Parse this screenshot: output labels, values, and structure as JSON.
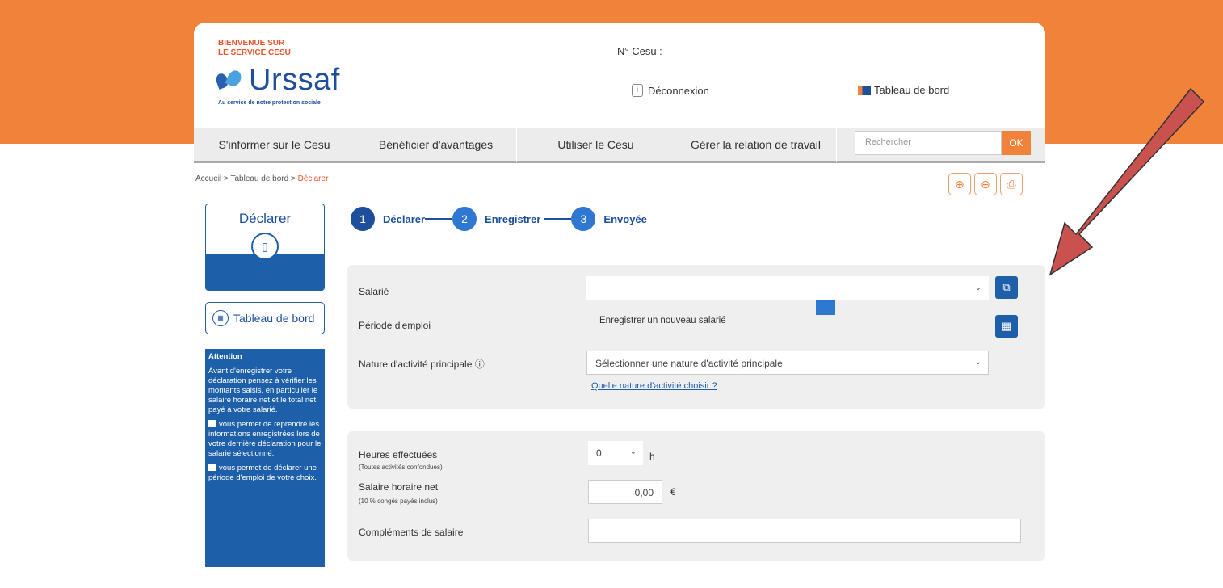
{
  "header": {
    "welcome_line1": "BIENVENUE SUR",
    "welcome_line2": "LE SERVICE CESU",
    "logo_text": "Urssaf",
    "logo_tagline": "Au service de notre protection sociale",
    "cesu_number_label": "N° Cesu :",
    "logout_label": "Déconnexion",
    "dashboard_label": "Tableau de bord"
  },
  "nav": {
    "items": [
      {
        "label": "S'informer sur le Cesu"
      },
      {
        "label": "Bénéficier d'avantages"
      },
      {
        "label": "Utiliser le Cesu"
      },
      {
        "label": "Gérer la relation de travail"
      }
    ],
    "search_placeholder": "Rechercher",
    "search_button": "OK"
  },
  "breadcrumb": {
    "home": "Accueil",
    "sep": " > ",
    "dashboard": "Tableau de bord",
    "current": "Déclarer"
  },
  "sidebar": {
    "declare_title": "Déclarer",
    "dashboard_button": "Tableau de bord",
    "attention_title": "Attention",
    "attention_p1": "Avant d'enregistrer votre déclaration pensez à vérifier les montants saisis, en particulier le salaire horaire net et le total net payé à votre salarié.",
    "attention_p2": "vous permet de reprendre les informations enregistrées lors de votre dernière déclaration pour le salarié sélectionné.",
    "attention_p3": "vous permet de déclarer une période d'emploi de votre choix."
  },
  "steps": [
    {
      "num": "1",
      "label": "Déclarer",
      "color": "#1d4f9c"
    },
    {
      "num": "2",
      "label": "Enregistrer",
      "color": "#2e78d2"
    },
    {
      "num": "3",
      "label": "Envoyée",
      "color": "#2e78d2"
    }
  ],
  "form": {
    "salarie_label": "Salarié",
    "salarie_value": "",
    "dropdown_option": "Enregistrer un nouveau salarié",
    "periode_label": "Période d'emploi",
    "nature_label": "Nature d'activité principale",
    "nature_placeholder": "Sélectionner une nature d'activité principale",
    "nature_link": "Quelle nature d'activité choisir ?",
    "heures_label": "Heures effectuées",
    "heures_sub": "(Toutes activités confondues)",
    "heures_value": "0",
    "heures_unit": "h",
    "salaire_label": "Salaire horaire net",
    "salaire_sub": "(10 % congés payés inclus)",
    "salaire_value": "0,00",
    "salaire_unit": "€",
    "complements_label": "Compléments de salaire",
    "complements_value": ""
  },
  "tools": {
    "zoom_in": "⊕",
    "zoom_out": "⊖",
    "print": "⎙"
  },
  "colors": {
    "brand_orange": "#f0823a",
    "brand_blue": "#1d4f9c",
    "arrow_red": "#c9524e"
  }
}
